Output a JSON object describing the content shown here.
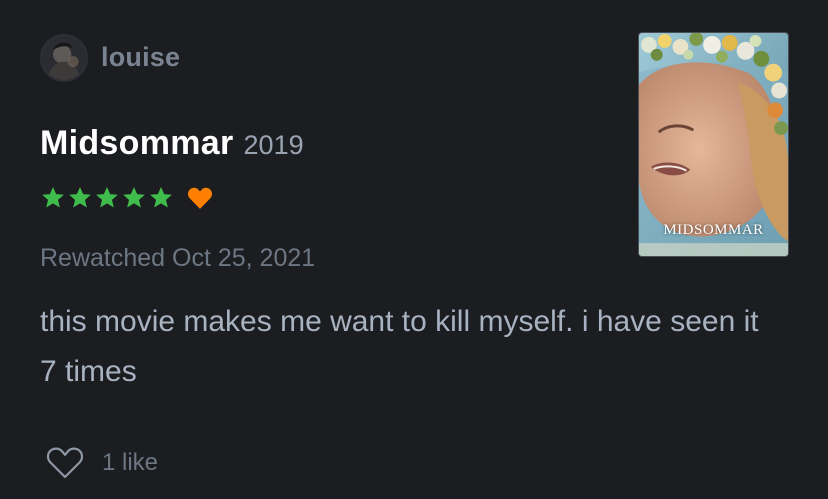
{
  "review": {
    "username": "louise",
    "film_title": "Midsommar",
    "film_year": "2019",
    "rating_stars": 5,
    "rating_max": 5,
    "liked": true,
    "watched_text": "Rewatched Oct 25, 2021",
    "text": "this movie makes me want to kill myself. i have seen it 7 times",
    "likes_text": "1 like",
    "poster_title": "MIDSOMMAR"
  },
  "colors": {
    "background": "#1b1d21",
    "star": "#40bc4d",
    "liked_heart": "#ff8000",
    "username": "#7a8391",
    "body_text": "#a8b2c1"
  },
  "icons": {
    "avatar": "avatar",
    "star": "star-icon",
    "liked": "heart-icon",
    "like_button": "heart-outline-icon"
  }
}
